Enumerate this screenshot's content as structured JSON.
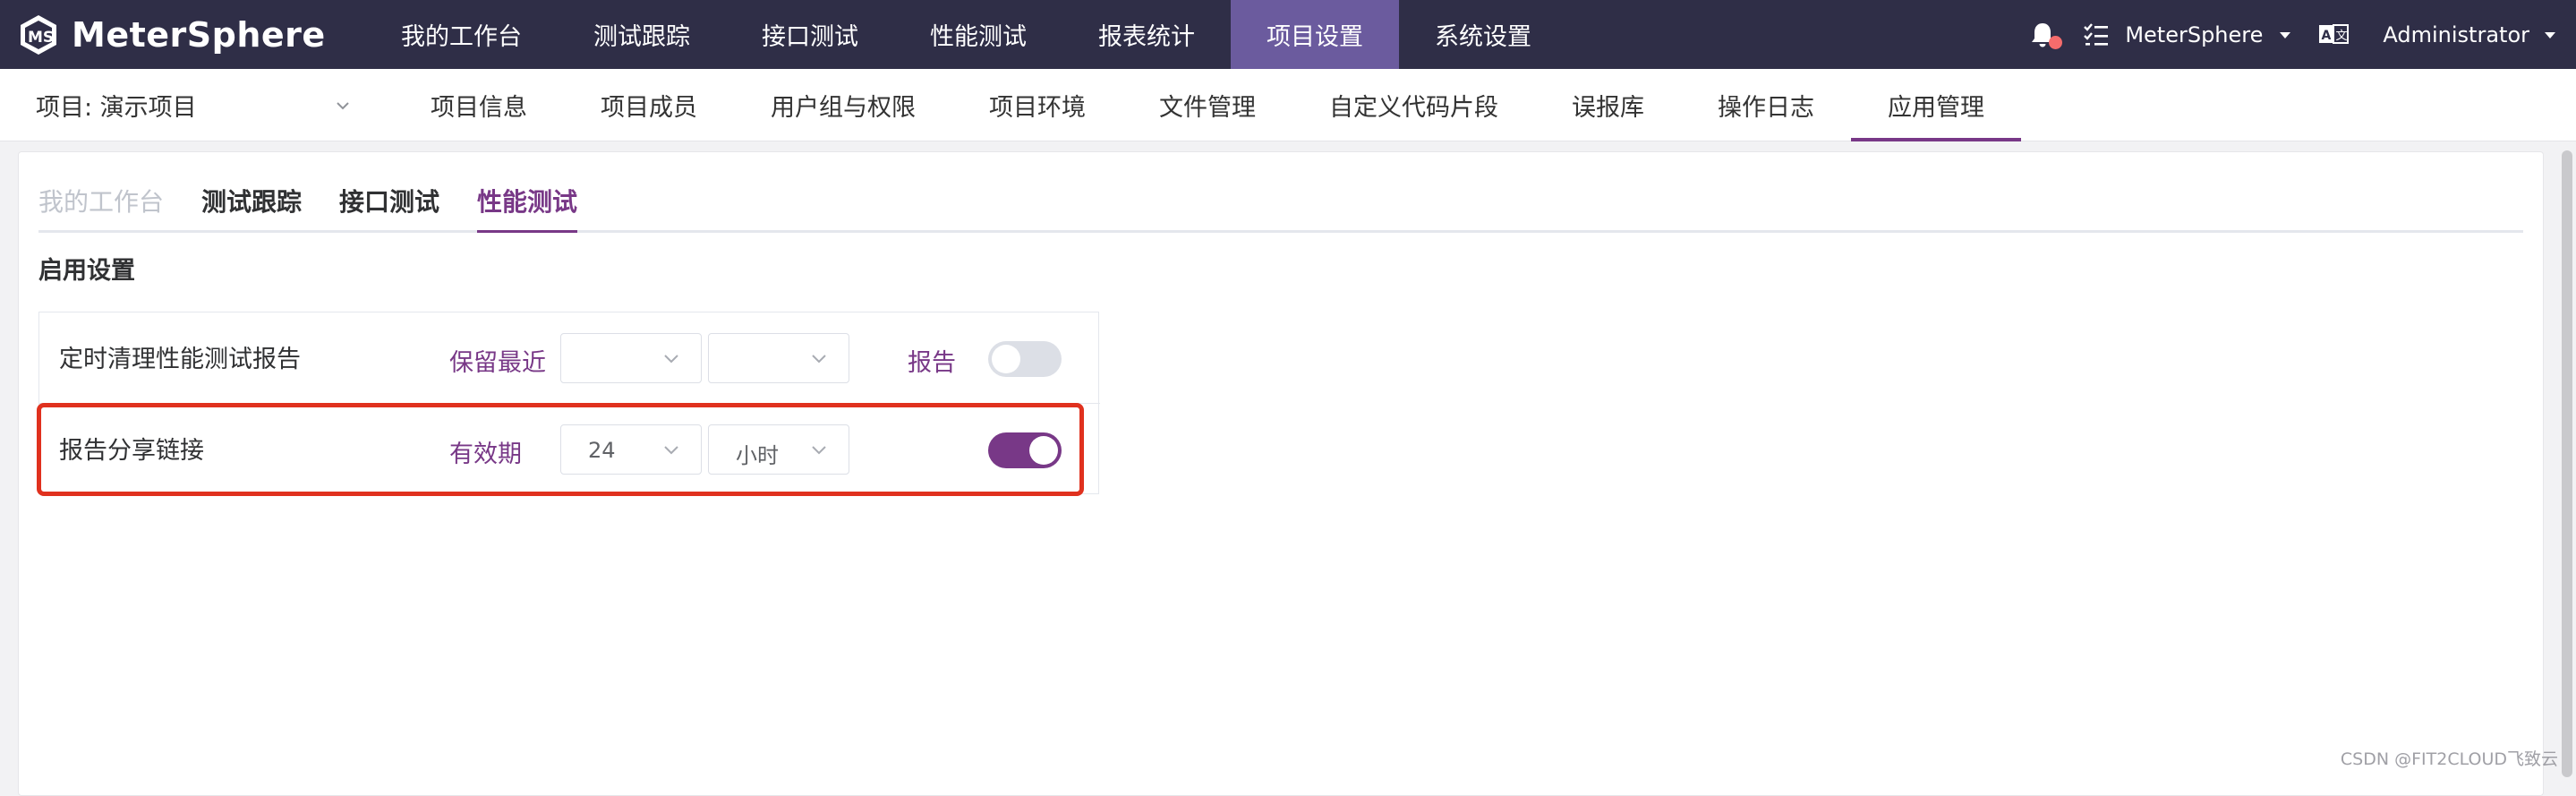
{
  "app": {
    "name": "MeterSphere",
    "colors": {
      "topbar_bg": "#2f2e47",
      "topnav_active_bg": "#6b5b9e",
      "accent": "#783887",
      "highlight": "#e0311e",
      "notification_dot": "#f56c6c"
    }
  },
  "topnav": {
    "items": [
      {
        "label": "我的工作台",
        "active": false
      },
      {
        "label": "测试跟踪",
        "active": false
      },
      {
        "label": "接口测试",
        "active": false
      },
      {
        "label": "性能测试",
        "active": false
      },
      {
        "label": "报表统计",
        "active": false
      },
      {
        "label": "项目设置",
        "active": true
      },
      {
        "label": "系统设置",
        "active": false
      }
    ],
    "workspace": "MeterSphere",
    "user": "Administrator",
    "icons": [
      "bell-icon",
      "task-list-icon",
      "caret-down-icon",
      "language-icon"
    ]
  },
  "subnav": {
    "project_label": "项目: 演示项目",
    "items": [
      {
        "label": "项目信息",
        "active": false
      },
      {
        "label": "项目成员",
        "active": false
      },
      {
        "label": "用户组与权限",
        "active": false
      },
      {
        "label": "项目环境",
        "active": false
      },
      {
        "label": "文件管理",
        "active": false
      },
      {
        "label": "自定义代码片段",
        "active": false
      },
      {
        "label": "误报库",
        "active": false
      },
      {
        "label": "操作日志",
        "active": false
      },
      {
        "label": "应用管理",
        "active": true
      }
    ]
  },
  "main": {
    "tabs": [
      {
        "label": "我的工作台",
        "state": "disabled"
      },
      {
        "label": "测试跟踪",
        "state": "normal"
      },
      {
        "label": "接口测试",
        "state": "normal"
      },
      {
        "label": "性能测试",
        "state": "active"
      }
    ],
    "section_title": "启用设置",
    "settings": [
      {
        "name": "定时清理性能测试报告",
        "label": "保留最近",
        "select1_value": "",
        "select2_value": "",
        "trailing_label": "报告",
        "enabled": false
      },
      {
        "name": "报告分享链接",
        "label": "有效期",
        "select1_value": "24",
        "select2_value": "小时",
        "trailing_label": "",
        "enabled": true
      }
    ]
  },
  "watermark": "CSDN @FIT2CLOUD飞致云"
}
